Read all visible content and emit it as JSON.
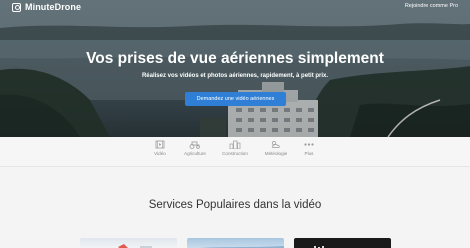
{
  "brand": {
    "name": "MinuteDrone"
  },
  "nav": {
    "pilot_link": "Rejoindre comme Pro"
  },
  "hero": {
    "title": "Vos prises de vue aériennes simplement",
    "subtitle": "Réalisez vos vidéos et photos aériennes, rapidement, à petit prix.",
    "cta_label": "Demandez une vidéo aériennes"
  },
  "categories": [
    {
      "label": "Vidéo",
      "icon": "video-icon"
    },
    {
      "label": "Agriculture",
      "icon": "tractor-icon"
    },
    {
      "label": "Construction",
      "icon": "building-icon"
    },
    {
      "label": "Météologie",
      "icon": "weather-icon"
    },
    {
      "label": "Plus",
      "icon": "more-icon"
    }
  ],
  "section": {
    "title": "Services Populaires dans la vidéo"
  },
  "colors": {
    "accent": "#2f7fd6",
    "category_text": "#888888",
    "section_title": "#333333"
  }
}
